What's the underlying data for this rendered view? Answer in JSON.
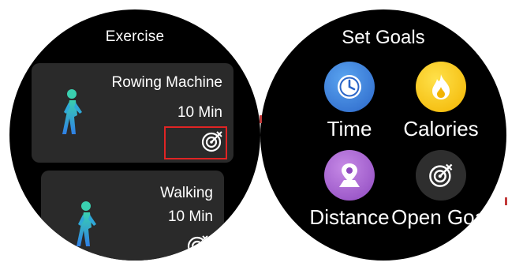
{
  "exercise_screen": {
    "title": "Exercise",
    "cards": [
      {
        "name": "Rowing Machine",
        "duration": "10 Min"
      },
      {
        "name": "Walking",
        "duration": "10 Min"
      }
    ]
  },
  "goals_screen": {
    "title": "Set Goals",
    "options": [
      {
        "label": "Time",
        "icon": "clock-icon",
        "color": "#3d82dd"
      },
      {
        "label": "Calories",
        "icon": "flame-icon",
        "color": "#f7c81c"
      },
      {
        "label": "Distance",
        "icon": "location-pin-icon",
        "color": "#a862d2"
      },
      {
        "label": "Open Goal",
        "icon": "target-icon",
        "color": "#2e2e2e"
      }
    ]
  },
  "colors": {
    "highlight": "#e02424",
    "card_bg": "#2a2a2a",
    "walker_head": "#3ad0b0",
    "walker_body": "#2f8fe0"
  }
}
